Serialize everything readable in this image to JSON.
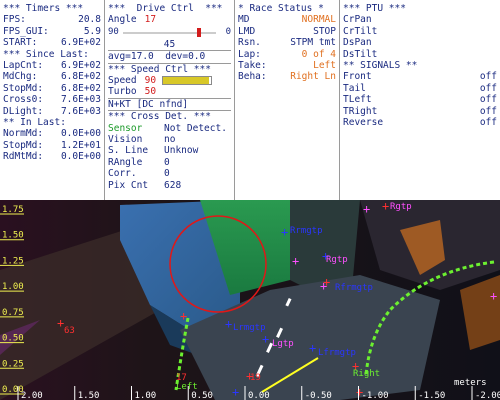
{
  "timers": {
    "header": "*** Timers ***",
    "rows": [
      {
        "label": "FPS:",
        "value": "20.8"
      },
      {
        "label": "FPS_GUI:",
        "value": "5.9"
      },
      {
        "label": "START:",
        "value": "6.9E+02"
      }
    ],
    "since_header": "*** Since Last:",
    "since_rows": [
      {
        "label": "LapCnt:",
        "value": "6.9E+02"
      },
      {
        "label": "MdChg:",
        "value": "6.8E+02"
      },
      {
        "label": "StopMd:",
        "value": "6.8E+02"
      },
      {
        "label": "Cross0:",
        "value": "7.6E+03"
      },
      {
        "label": "DLight:",
        "value": "7.6E+03"
      }
    ],
    "in_header": "** In Last:",
    "in_rows": [
      {
        "label": "NormMd:",
        "value": "0.0E+00"
      },
      {
        "label": "StopMd:",
        "value": "1.2E+01"
      },
      {
        "label": "RdMtMd:",
        "value": "0.0E+00"
      }
    ]
  },
  "drive": {
    "header": "***  Drive Ctrl  ***",
    "angle_label": "Angle",
    "angle_value": "17",
    "slider_min": "90",
    "slider_max": "0",
    "slider_level": 0.81,
    "slider_value": "45",
    "avg_text": "avg=17.0  dev=0.0",
    "speed_header": "*** Speed Ctrl ***",
    "speed_label": "Speed",
    "speed_value": "90",
    "turbo_label": "Turbo",
    "turbo_value": "50",
    "speed_bar_fill": 0.95,
    "nkt_text": "N+KT [DC nfnd]",
    "cross_header": "*** Cross Det. ***",
    "cross_rows": [
      {
        "label": "Sensor",
        "value": "Not Detect."
      },
      {
        "label": "Vision",
        "value": "no"
      },
      {
        "label": "S. Line",
        "value": "Unknow"
      },
      {
        "label": "RAngle",
        "value": "0"
      },
      {
        "label": "Corr.",
        "value": "0"
      },
      {
        "label": "Pix Cnt",
        "value": "628"
      }
    ]
  },
  "race": {
    "header": "* Race Status *",
    "rows": [
      {
        "label": "MD",
        "value": "NORMAL",
        "color": "#e07020"
      },
      {
        "label": "LMD",
        "value": "STOP",
        "color": "#1a2a80"
      },
      {
        "label": "Rsn.",
        "value": "STPM tmt",
        "color": "#1a2a80"
      },
      {
        "label": "Lap:",
        "value": "0 of 4",
        "color": "#e07020"
      },
      {
        "label": "Take:",
        "value": "Left",
        "color": "#e07020"
      },
      {
        "label": "Beha:",
        "value": "Right Ln",
        "color": "#e07020"
      }
    ]
  },
  "ptu": {
    "header": "*** PTU ***",
    "items": [
      "CrPan",
      "CrTilt",
      "DsPan",
      "DsTilt"
    ],
    "signals_header": "** SIGNALS **",
    "signals": [
      {
        "label": "Front",
        "value": "off"
      },
      {
        "label": "Tail",
        "value": "off"
      },
      {
        "label": "TLeft",
        "value": "off"
      },
      {
        "label": "TRight",
        "value": "off"
      },
      {
        "label": "Reverse",
        "value": "off"
      }
    ]
  },
  "camera": {
    "y_ticks": [
      "1.75",
      "1.50",
      "1.25",
      "1.00",
      "0.75",
      "0.50",
      "0.25",
      "0.00"
    ],
    "x_ticks": [
      "2.00",
      "1.50",
      "1.00",
      "0.50",
      "0.00",
      "-0.50",
      "-1.00",
      "-1.50",
      "-2.00"
    ],
    "x_unit": "meters",
    "labels": {
      "rgtp_top": "Rgtp",
      "rrmgtp": "Rrmgtp",
      "rgtp_mid": "Rgtp",
      "rfrmgtp": "Rfrmgtp",
      "lrmgtp": "Lrmgtp",
      "lgtp": "Lgtp",
      "lfrmgtp": "Lfrmgtp",
      "left_line": "Left",
      "right_line": "Right",
      "num_left": "63",
      "num_bottom_left": "17",
      "num_bottom_mid": "19"
    },
    "colors": {
      "lane_green": "#6cf030",
      "circle_red": "#e01818",
      "marker_blue": "#2a36ff",
      "marker_red": "#ff3030",
      "marker_pink": "#ff50ff",
      "heading_yellow": "#ffff22",
      "tick_yellow": "#f0f050"
    }
  }
}
